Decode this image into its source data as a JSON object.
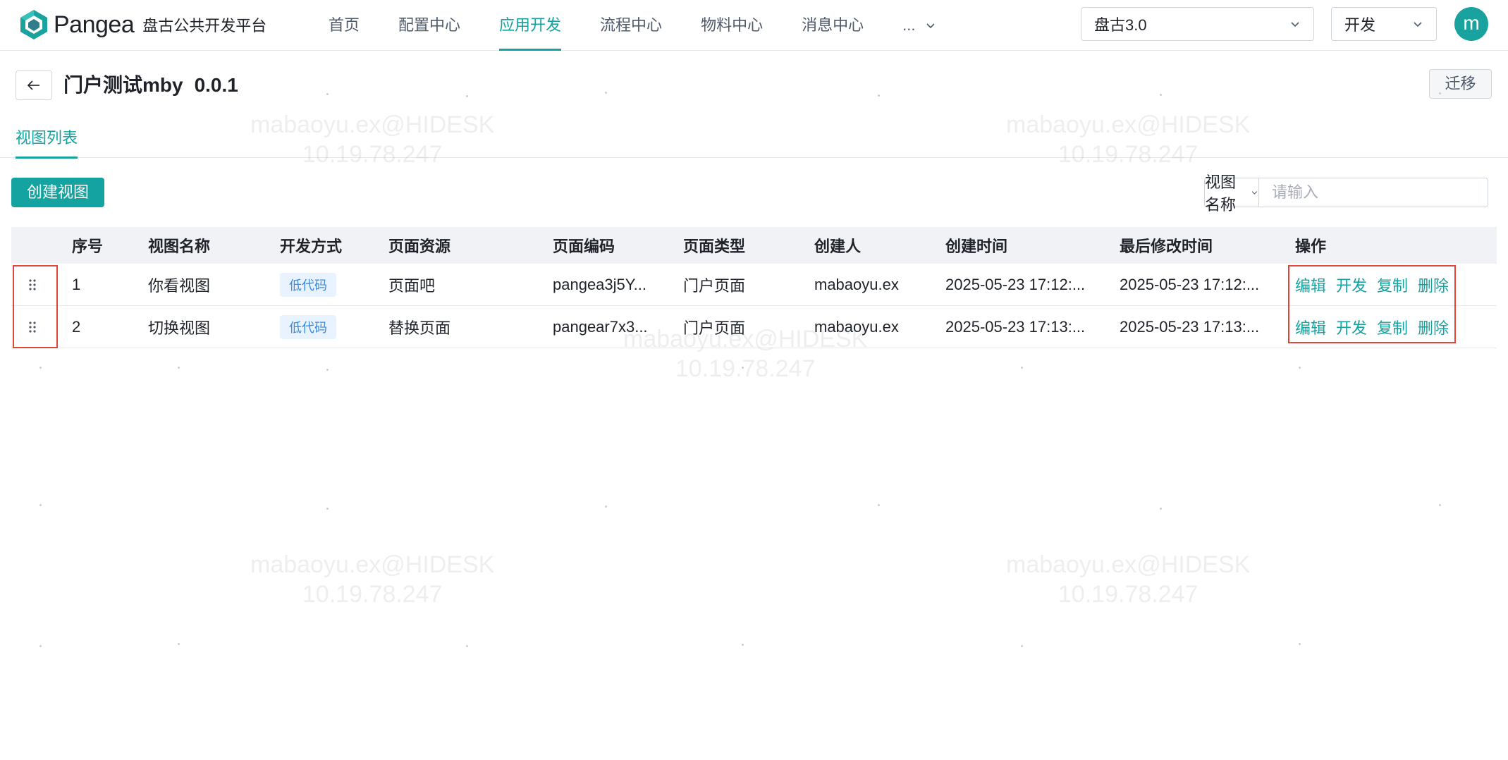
{
  "brand": {
    "name": "Pangea",
    "subtitle": "盘古公共开发平台"
  },
  "nav": {
    "items": [
      {
        "label": "首页",
        "active": false
      },
      {
        "label": "配置中心",
        "active": false
      },
      {
        "label": "应用开发",
        "active": true
      },
      {
        "label": "流程中心",
        "active": false
      },
      {
        "label": "物料中心",
        "active": false
      },
      {
        "label": "消息中心",
        "active": false
      }
    ],
    "more_label": "..."
  },
  "header": {
    "project_select": "盘古3.0",
    "env_select": "开发",
    "avatar_initial": "m"
  },
  "page": {
    "title": "门户测试mby",
    "version": "0.0.1",
    "migrate_label": "迁移",
    "tab_label": "视图列表"
  },
  "toolbar": {
    "create_label": "创建视图",
    "search_field": "视图名称",
    "search_placeholder": "请输入"
  },
  "table": {
    "columns": [
      "序号",
      "视图名称",
      "开发方式",
      "页面资源",
      "页面编码",
      "页面类型",
      "创建人",
      "创建时间",
      "最后修改时间",
      "操作"
    ],
    "rows": [
      {
        "index": "1",
        "name": "你看视图",
        "mode": "低代码",
        "source": "页面吧",
        "code": "pangea3j5Y...",
        "page_type": "门户页面",
        "creator": "mabaoyu.ex",
        "created": "2025-05-23 17:12:...",
        "modified": "2025-05-23 17:12:..."
      },
      {
        "index": "2",
        "name": "切换视图",
        "mode": "低代码",
        "source": "替换页面",
        "code": "pangear7x3...",
        "page_type": "门户页面",
        "creator": "mabaoyu.ex",
        "created": "2025-05-23 17:13:...",
        "modified": "2025-05-23 17:13:..."
      }
    ],
    "actions": [
      "编辑",
      "开发",
      "复制",
      "删除"
    ]
  },
  "watermark": {
    "line1": "mabaoyu.ex@HIDESK",
    "line2": "10.19.78.247"
  },
  "colors": {
    "accent": "#14a3a0",
    "highlight": "#e0453a",
    "badge_bg": "#e8f3ff",
    "badge_text": "#3c8bdc"
  }
}
